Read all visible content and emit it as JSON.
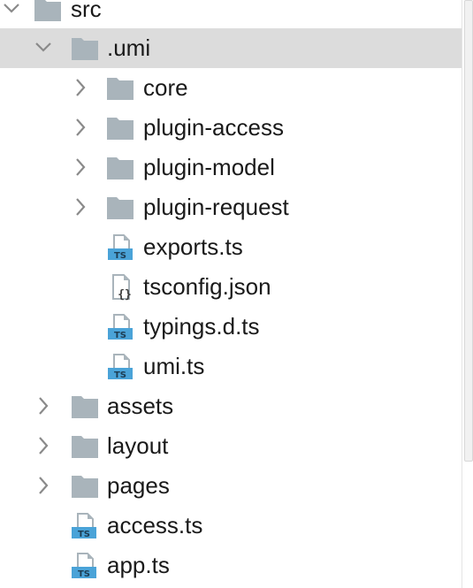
{
  "tree": {
    "src": {
      "label": "src",
      "state": "expanded",
      "icon": "folder-icon"
    },
    "umi": {
      "label": ".umi",
      "state": "expanded",
      "selected": true,
      "icon": "folder-icon"
    },
    "core": {
      "label": "core",
      "state": "collapsed",
      "icon": "folder-icon"
    },
    "plugin_access": {
      "label": "plugin-access",
      "state": "collapsed",
      "icon": "folder-icon"
    },
    "plugin_model": {
      "label": "plugin-model",
      "state": "collapsed",
      "icon": "folder-icon"
    },
    "plugin_request": {
      "label": "plugin-request",
      "state": "collapsed",
      "icon": "folder-icon"
    },
    "exports_ts": {
      "label": "exports.ts",
      "icon": "typescript-file-icon",
      "badge": "TS"
    },
    "tsconfig_json": {
      "label": "tsconfig.json",
      "icon": "json-file-icon",
      "badge": "{}"
    },
    "typings_d_ts": {
      "label": "typings.d.ts",
      "icon": "typescript-file-icon",
      "badge": "TS"
    },
    "umi_ts": {
      "label": "umi.ts",
      "icon": "typescript-file-icon",
      "badge": "TS"
    },
    "assets": {
      "label": "assets",
      "state": "collapsed",
      "icon": "folder-icon"
    },
    "layout": {
      "label": "layout",
      "state": "collapsed",
      "icon": "folder-icon"
    },
    "pages": {
      "label": "pages",
      "state": "collapsed",
      "icon": "folder-icon"
    },
    "access_ts": {
      "label": "access.ts",
      "icon": "typescript-file-icon",
      "badge": "TS"
    },
    "app_ts": {
      "label": "app.ts",
      "icon": "typescript-file-icon",
      "badge": "TS"
    }
  },
  "colors": {
    "folder": "#a9b4bb",
    "ts_badge": "#4aa3d8",
    "file_page": "#a9b4bb",
    "chevron": "#8a8a8a",
    "selected_row": "#dcdcdc"
  }
}
